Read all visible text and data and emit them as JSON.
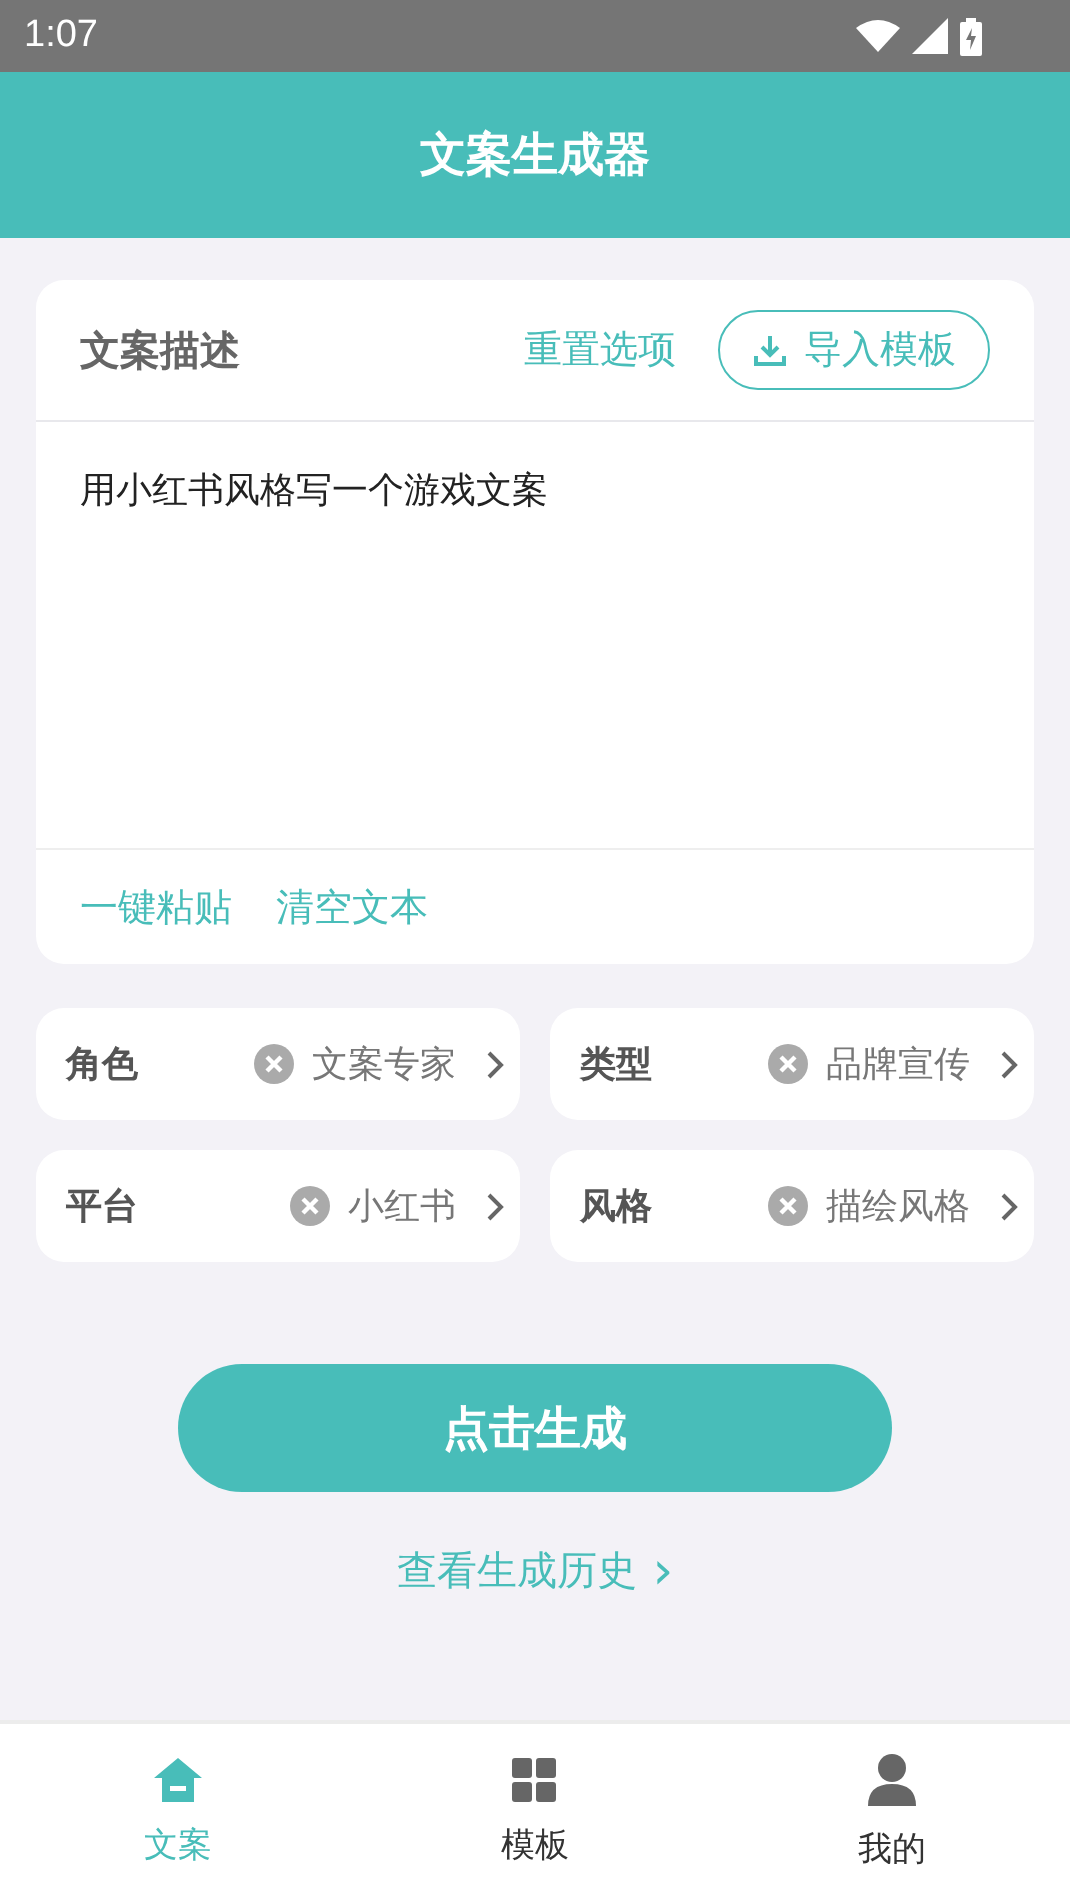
{
  "status_bar": {
    "time": "1:07"
  },
  "header": {
    "title": "文案生成器"
  },
  "description_card": {
    "title": "文案描述",
    "reset_link": "重置选项",
    "import_button": "导入模板",
    "text": "用小红书风格写一个游戏文案",
    "actions": [
      "一键粘贴",
      "清空文本"
    ]
  },
  "options": [
    {
      "label": "角色",
      "value": "文案专家"
    },
    {
      "label": "类型",
      "value": "品牌宣传"
    },
    {
      "label": "平台",
      "value": "小红书"
    },
    {
      "label": "风格",
      "value": "描绘风格"
    }
  ],
  "generate_button": "点击生成",
  "history_link": "查看生成历史",
  "history_arrow": "›",
  "bottom_nav": [
    {
      "label": "文案",
      "kind": "home",
      "selected": true
    },
    {
      "label": "模板",
      "kind": "grid",
      "selected": false
    },
    {
      "label": "我的",
      "kind": "person",
      "selected": false
    }
  ]
}
